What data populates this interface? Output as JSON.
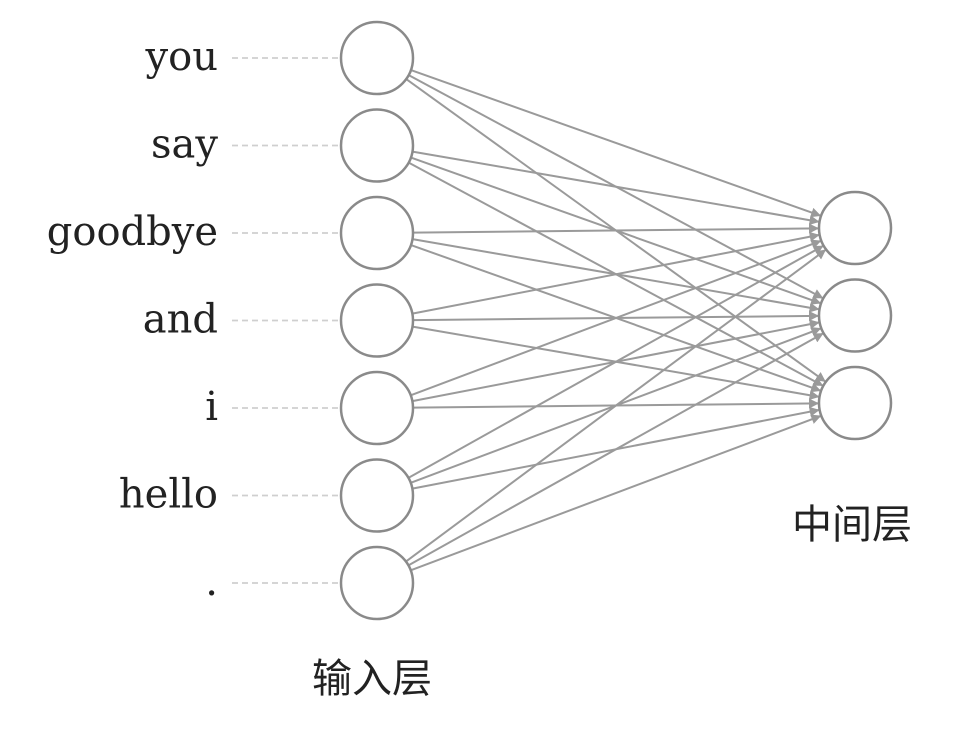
{
  "input_words": [
    "you",
    "say",
    "goodbye",
    "and",
    "i",
    "hello",
    "."
  ],
  "input_layer_label": "输入层",
  "hidden_layer_label": "中间层",
  "hidden_neuron_count": 3,
  "colors": {
    "edge": "#9a9a9a",
    "node_stroke": "#8a8a8a",
    "dash": "#cfcfcf",
    "text": "#222222"
  }
}
